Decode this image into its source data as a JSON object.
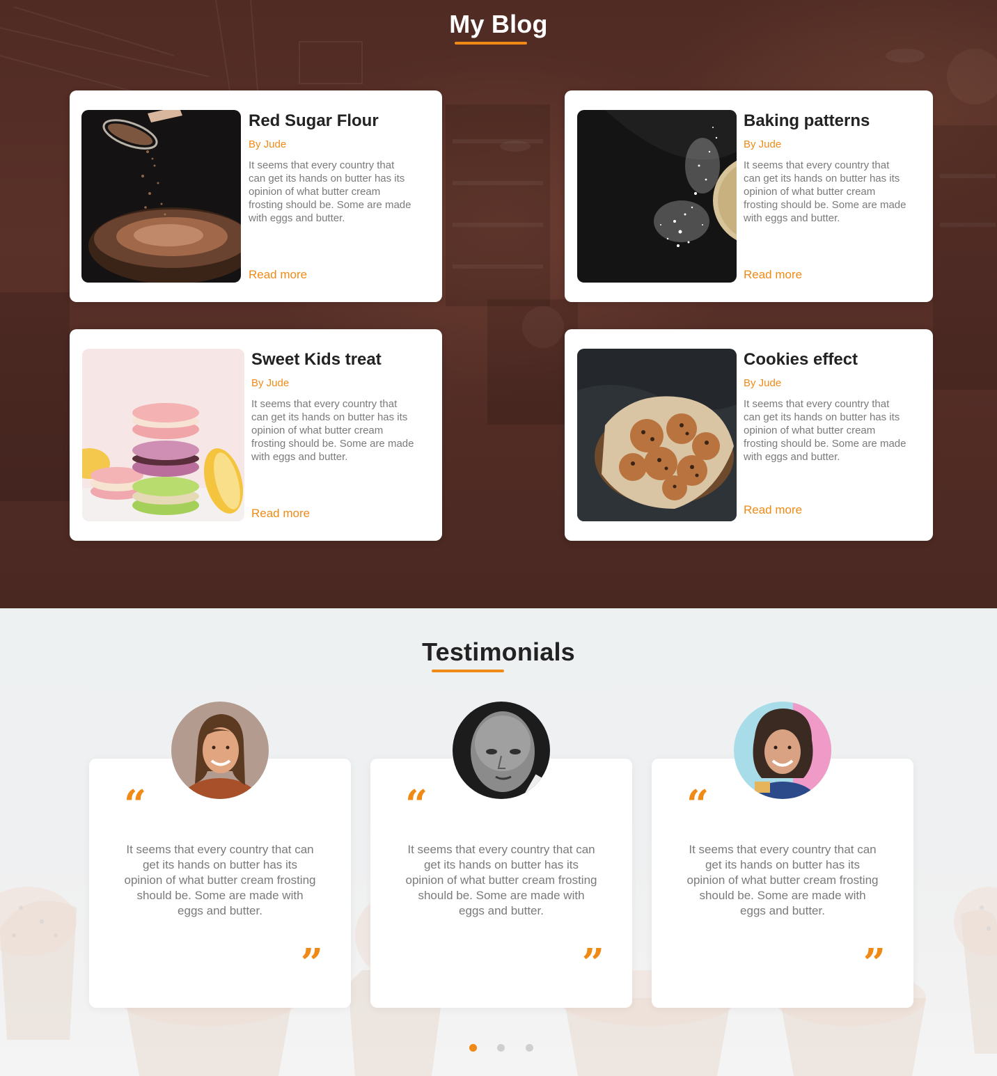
{
  "blog": {
    "title": "My Blog",
    "read_more_label": "Read more",
    "posts": [
      {
        "title": "Red Sugar Flour",
        "author": "By Jude",
        "excerpt": "It seems that every country that can get its hands on butter has its opinion of what butter cream frosting should be. Some are made with eggs and butter.",
        "image_icon": "cake-sifting-photo"
      },
      {
        "title": "Baking patterns",
        "author": "By Jude",
        "excerpt": "It seems that every country that can get its hands on butter has its opinion of what butter cream frosting should be. Some are made with eggs and butter.",
        "image_icon": "flour-dust-photo"
      },
      {
        "title": "Sweet Kids treat",
        "author": "By Jude",
        "excerpt": "It seems that every country that can get its hands on butter has its opinion of what butter cream frosting should be. Some are made with eggs and butter.",
        "image_icon": "macarons-photo"
      },
      {
        "title": "Cookies effect",
        "author": "By Jude",
        "excerpt": "It seems that every country that can get its hands on butter has its opinion of what butter cream frosting should be. Some are made with eggs and butter.",
        "image_icon": "cookies-bowl-photo"
      }
    ]
  },
  "testimonials": {
    "title": "Testimonials",
    "items": [
      {
        "quote_open": "“",
        "quote_close": "”",
        "text": "It seems that every country that can get its hands on butter has its opinion of what butter cream frosting should be. Some are made with eggs and butter.",
        "avatar_icon": "woman-avatar"
      },
      {
        "quote_open": "“",
        "quote_close": "”",
        "text": "It seems that every country that can get its hands on butter has its opinion of what butter cream frosting should be. Some are made with eggs and butter.",
        "avatar_icon": "man-avatar-bw"
      },
      {
        "quote_open": "“",
        "quote_close": "”",
        "text": "It seems that every country that can get its hands on butter has its opinion of what butter cream frosting should be. Some are made with eggs and butter.",
        "avatar_icon": "woman-avatar-2"
      }
    ],
    "pagination": {
      "pages": 3,
      "active_page": 1
    }
  },
  "colors": {
    "accent": "#f08a17",
    "blog_bg": "#532d26",
    "heading_dark": "#222222",
    "body_text": "#7a7a7a"
  }
}
